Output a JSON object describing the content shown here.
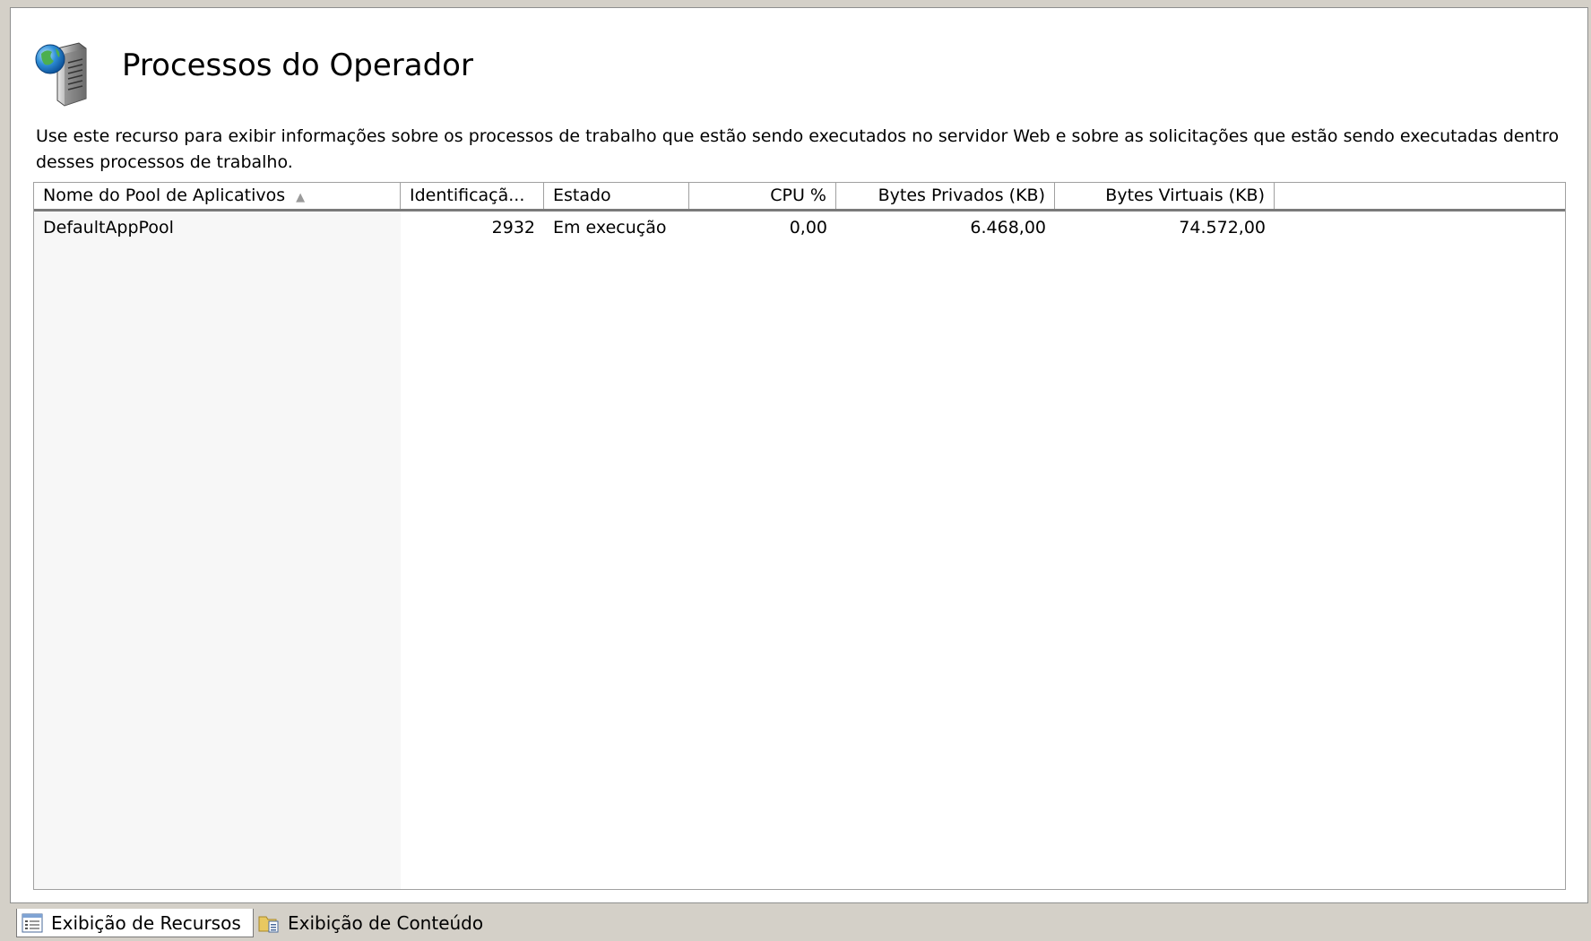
{
  "page": {
    "title": "Processos do Operador",
    "description": "Use este recurso para exibir informações sobre os processos de trabalho que estão sendo executados no servidor Web e sobre as solicitações que estão sendo executadas dentro desses processos de trabalho.",
    "icon": "server-globe-icon"
  },
  "grid": {
    "columns": [
      {
        "label": "Nome do Pool de Aplicativos",
        "sort": "ascending"
      },
      {
        "label": "Identificaçã..."
      },
      {
        "label": "Estado"
      },
      {
        "label": "CPU %"
      },
      {
        "label": "Bytes Privados (KB)"
      },
      {
        "label": "Bytes Virtuais (KB)"
      }
    ],
    "rows": [
      {
        "pool": "DefaultAppPool",
        "id": "2932",
        "state": "Em execução",
        "cpu": "0,00",
        "private_bytes": "6.468,00",
        "virtual_bytes": "74.572,00"
      }
    ]
  },
  "tabs": [
    {
      "label": "Exibição de Recursos",
      "icon": "features-view-icon",
      "active": true
    },
    {
      "label": "Exibição de Conteúdo",
      "icon": "content-view-icon",
      "active": false
    }
  ]
}
